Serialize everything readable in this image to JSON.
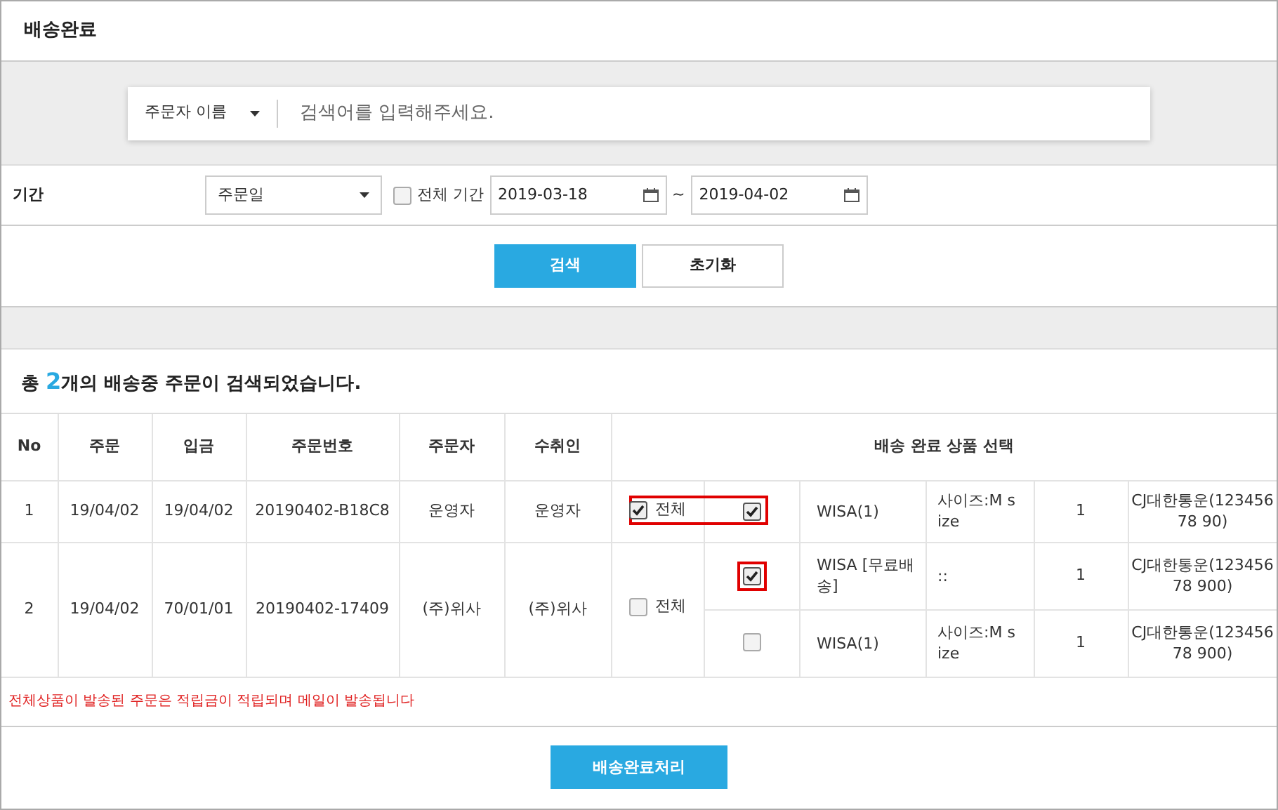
{
  "title": "배송완료",
  "search": {
    "type_label": "주문자 이름",
    "placeholder": "검색어를 입력해주세요."
  },
  "period": {
    "label": "기간",
    "date_type": "주문일",
    "all_period_checked": false,
    "all_period_label": "전체 기간",
    "from": "2019-03-18",
    "to": "2019-04-02",
    "separator": "~"
  },
  "buttons": {
    "search": "검색",
    "reset": "초기화"
  },
  "summary": {
    "prefix": "총 ",
    "count": "2",
    "suffix": "개의 배송중 주문이 검색되었습니다."
  },
  "table": {
    "columns": [
      "No",
      "주문",
      "입금",
      "주문번호",
      "주문자",
      "수취인",
      "배송 완료 상품 선택"
    ],
    "rows": [
      {
        "no": "1",
        "order_date": "19/04/02",
        "paid_date": "19/04/02",
        "order_no": "20190402-B18C8",
        "orderer": "운영자",
        "recipient": "운영자",
        "all_checked": true,
        "all_label": "전체",
        "highlighted": true,
        "items": [
          {
            "checked": true,
            "highlighted": false,
            "product": "WISA(1)",
            "option": "사이즈:M s ize",
            "qty": "1",
            "carrier": "CJ대한통운(12345678 90)"
          }
        ]
      },
      {
        "no": "2",
        "order_date": "19/04/02",
        "paid_date": "70/01/01",
        "order_no": "20190402-17409",
        "orderer": "(주)위사",
        "recipient": "(주)위사",
        "all_checked": false,
        "all_label": "전체",
        "highlighted": false,
        "items": [
          {
            "checked": true,
            "highlighted": true,
            "product": "WISA [무료배 송]",
            "option": "::",
            "qty": "1",
            "carrier": "CJ대한통운(12345678 900)"
          },
          {
            "checked": false,
            "highlighted": false,
            "product": "WISA(1)",
            "option": "사이즈:M s ize",
            "qty": "1",
            "carrier": "CJ대한통운(12345678 900)"
          }
        ]
      }
    ]
  },
  "notice": "전체상품이 발송된 주문은 적립금이 적립되며 메일이 발송됩니다",
  "submit": "배송완료처리"
}
